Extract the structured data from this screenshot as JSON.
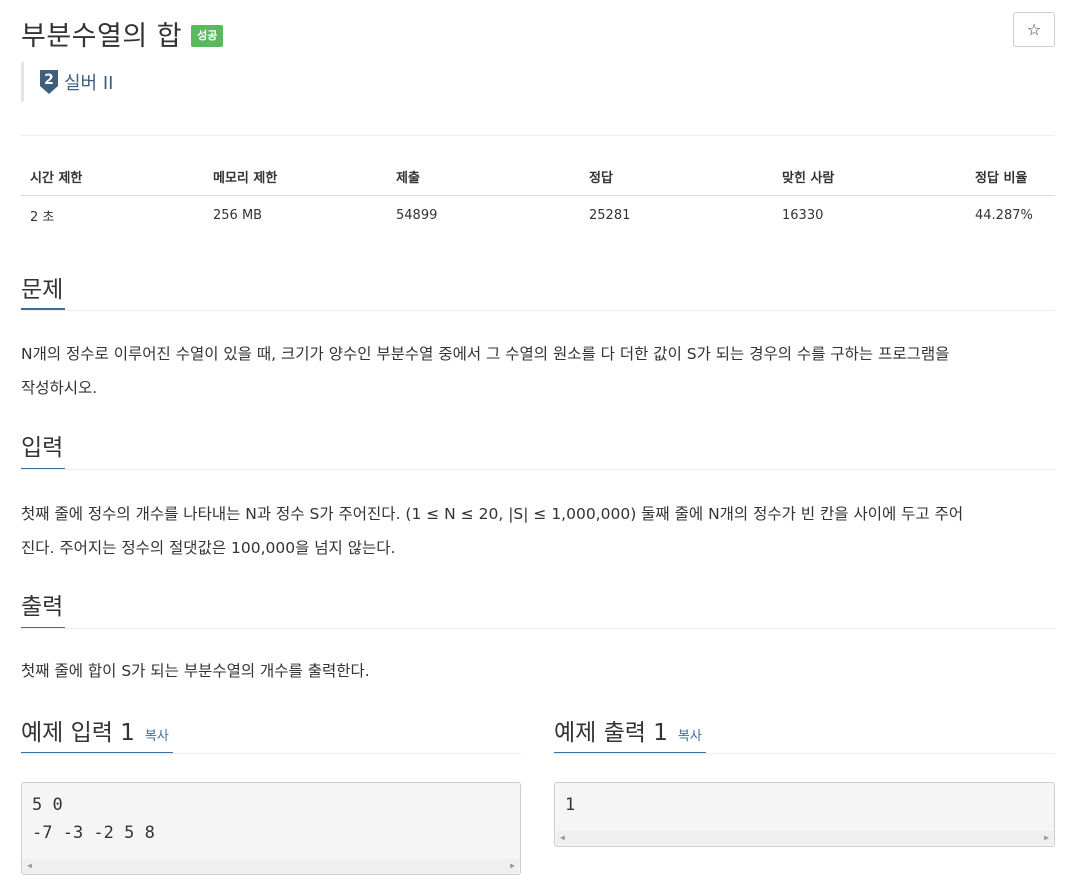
{
  "problem": {
    "title": "부분수열의 합",
    "status_badge": "성공",
    "star_icon": "☆",
    "tier": {
      "number": "2",
      "label": "실버 II",
      "color": "#3f5f7a"
    }
  },
  "info_table": {
    "headers": [
      "시간 제한",
      "메모리 제한",
      "제출",
      "정답",
      "맞힌 사람",
      "정답 비율"
    ],
    "values": [
      "2 초",
      "256 MB",
      "54899",
      "25281",
      "16330",
      "44.287%"
    ]
  },
  "sections": {
    "problem": {
      "title": "문제",
      "lines": [
        "N개의 정수로 이루어진 수열이 있을 때, 크기가 양수인 부분수열 중에서 그 수열의 원소를 다 더한 값이 S가 되는 경우의 수를 구하는 프로그램을",
        "작성하시오."
      ]
    },
    "input": {
      "title": "입력",
      "lines": [
        "첫째 줄에 정수의 개수를 나타내는 N과 정수 S가 주어진다. (1 ≤ N ≤ 20, |S| ≤ 1,000,000) 둘째 줄에 N개의 정수가 빈 칸을 사이에 두고 주어",
        "진다. 주어지는 정수의 절댓값은 100,000을 넘지 않는다."
      ]
    },
    "output": {
      "title": "출력",
      "lines": [
        "첫째 줄에 합이 S가 되는 부분수열의 개수를 출력한다."
      ]
    }
  },
  "examples": {
    "input": {
      "title": "예제 입력 1",
      "copy_label": "복사",
      "lines": [
        "5 0",
        "-7 -3 -2 5 8"
      ]
    },
    "output": {
      "title": "예제 출력 1",
      "copy_label": "복사",
      "lines": [
        "1"
      ]
    }
  },
  "colors": {
    "accent": "#3a6f9f",
    "success": "#5cb85c"
  }
}
